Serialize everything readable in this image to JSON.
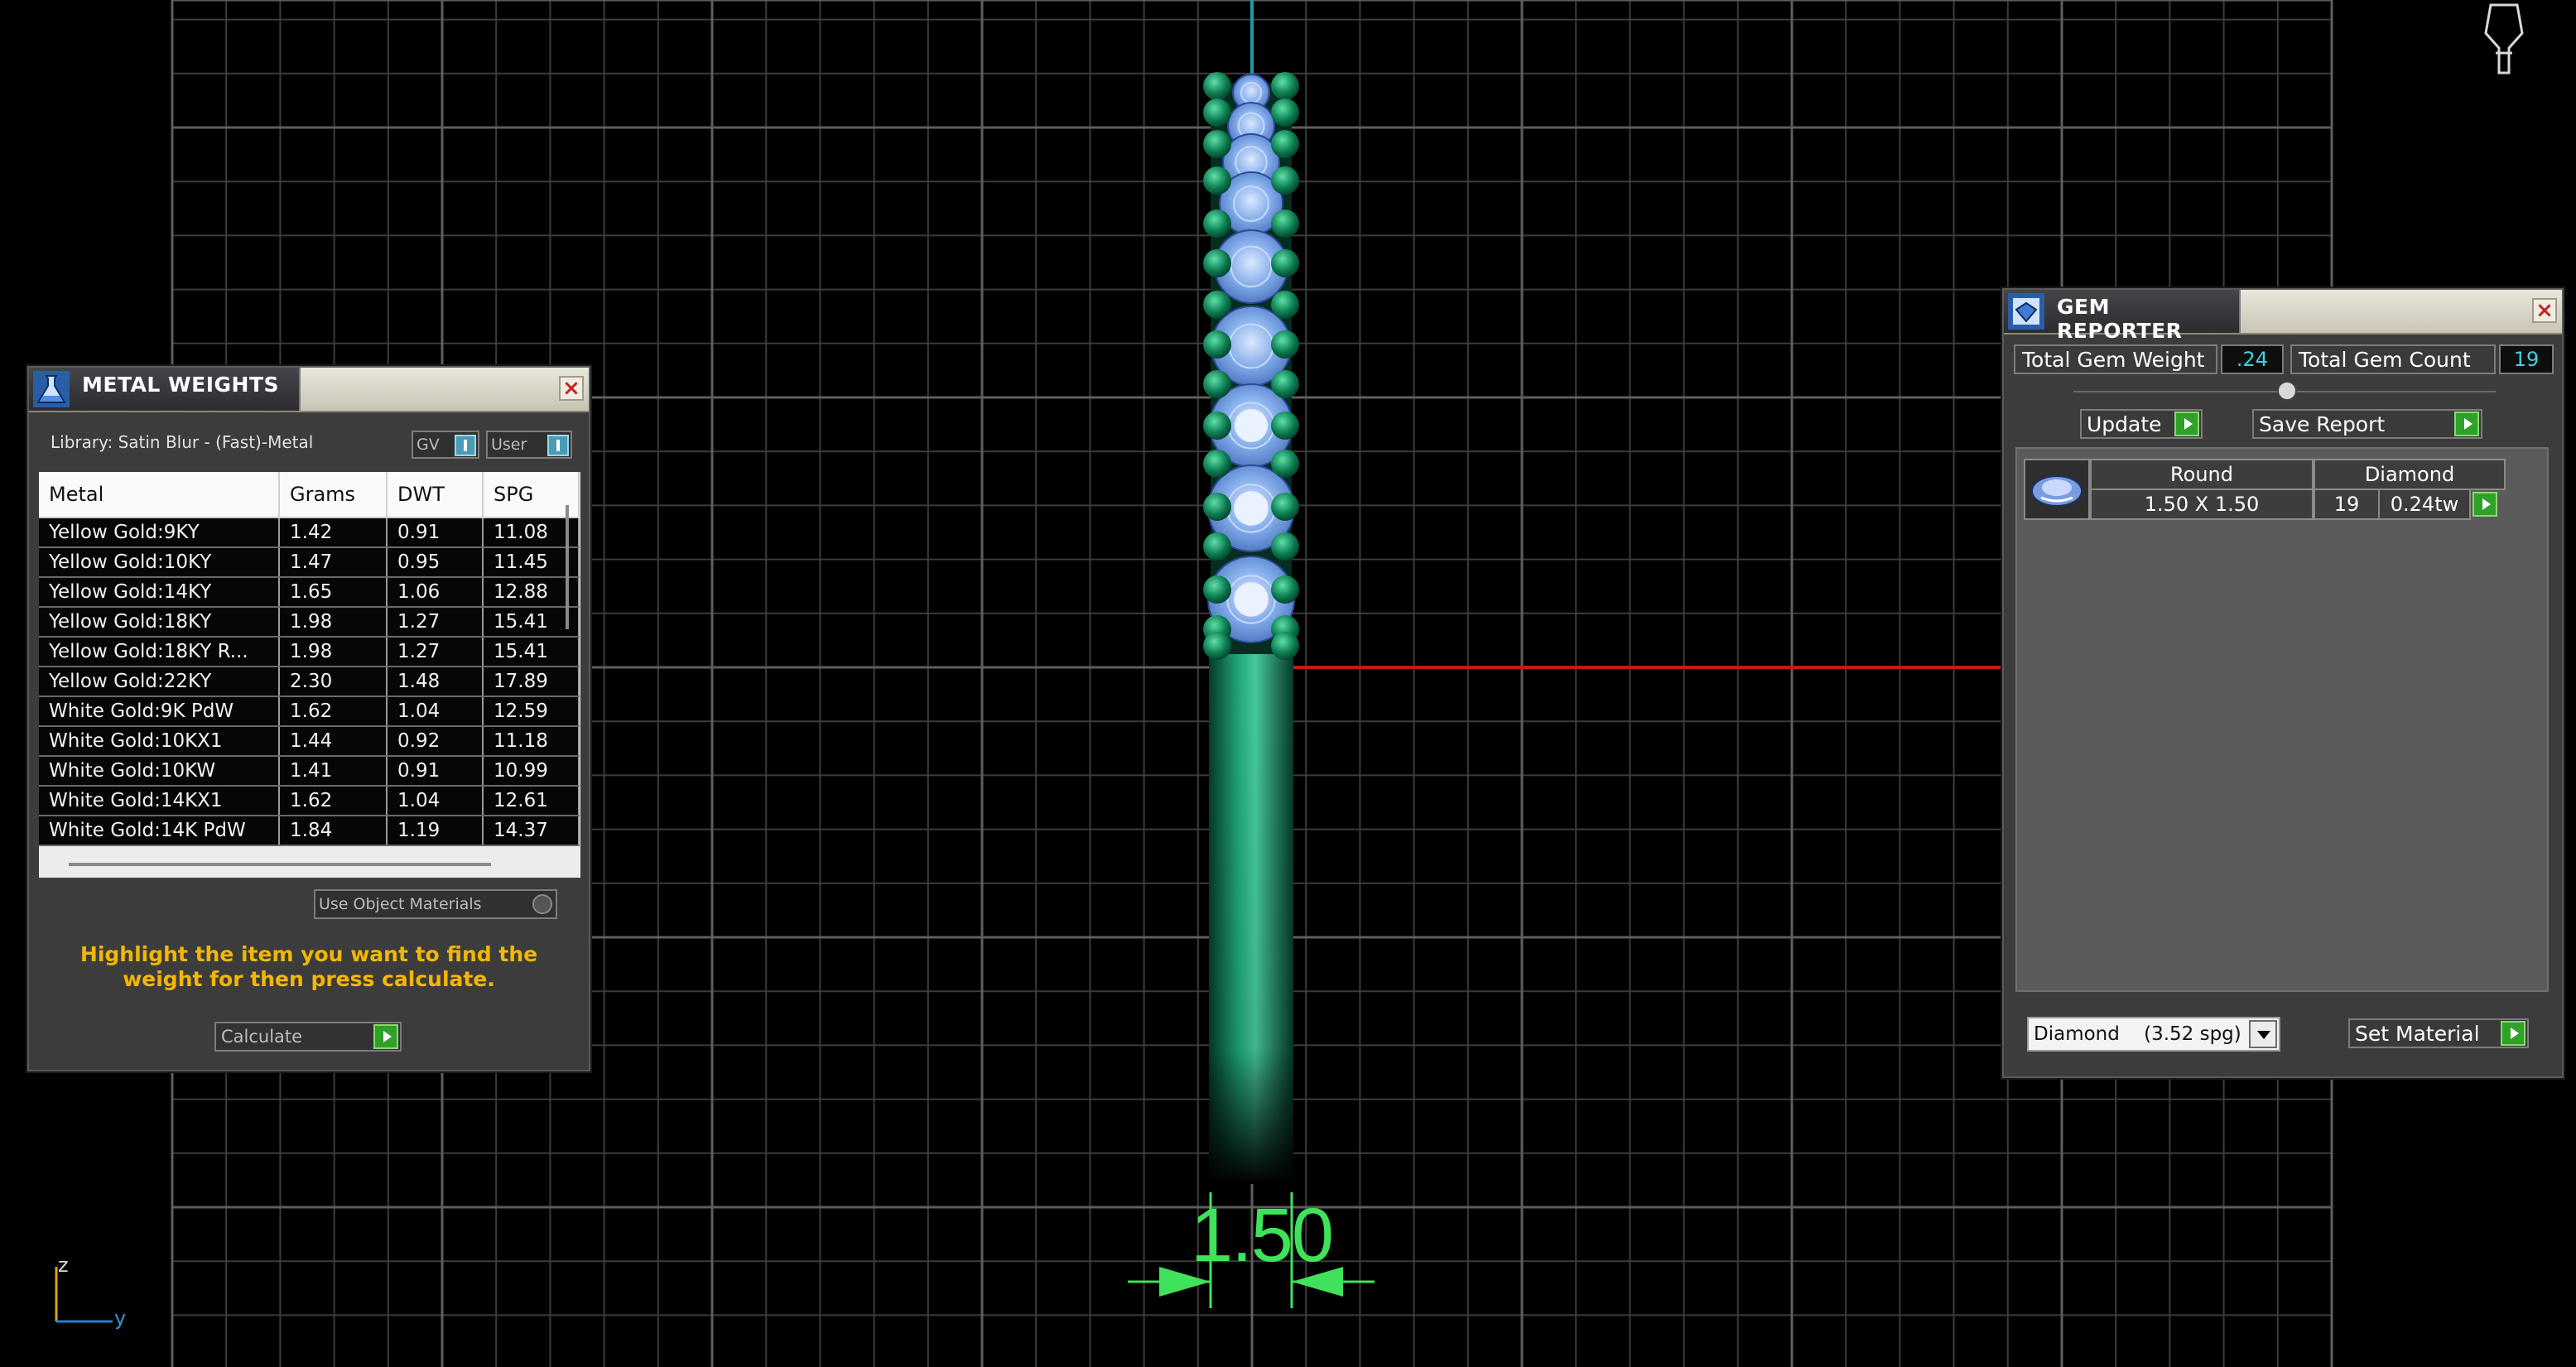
{
  "viewport": {
    "dimension_value": "1.50",
    "axis_labels": {
      "z": "z",
      "y": "y"
    },
    "colors": {
      "grid": "#5e5e5e",
      "ring": "#0a7a55",
      "gem": "#7eaee6",
      "dimension": "#3fe25a",
      "axis_red": "#c8161a",
      "axis_cyan": "#1e9aa8"
    }
  },
  "metal_weights": {
    "title": "METAL WEIGHTS",
    "library": "Library: Satin Blur - (Fast)-Metal",
    "toggles": {
      "gv": "GV",
      "user": "User"
    },
    "columns": [
      "Metal",
      "Grams",
      "DWT",
      "SPG"
    ],
    "rows": [
      [
        "Yellow Gold:9KY",
        "1.42",
        "0.91",
        "11.08"
      ],
      [
        "Yellow Gold:10KY",
        "1.47",
        "0.95",
        "11.45"
      ],
      [
        "Yellow Gold:14KY",
        "1.65",
        "1.06",
        "12.88"
      ],
      [
        "Yellow Gold:18KY",
        "1.98",
        "1.27",
        "15.41"
      ],
      [
        "Yellow Gold:18KY R...",
        "1.98",
        "1.27",
        "15.41"
      ],
      [
        "Yellow Gold:22KY",
        "2.30",
        "1.48",
        "17.89"
      ],
      [
        "White Gold:9K PdW",
        "1.62",
        "1.04",
        "12.59"
      ],
      [
        "White Gold:10KX1",
        "1.44",
        "0.92",
        "11.18"
      ],
      [
        "White Gold:10KW",
        "1.41",
        "0.91",
        "10.99"
      ],
      [
        "White Gold:14KX1",
        "1.62",
        "1.04",
        "12.61"
      ],
      [
        "White Gold:14K PdW",
        "1.84",
        "1.19",
        "14.37"
      ]
    ],
    "use_object_materials": "Use Object Materials",
    "hint": "Highlight the item you want to find the weight for then press calculate.",
    "calculate": "Calculate"
  },
  "gem_reporter": {
    "title": "GEM REPORTER",
    "total_weight_label": "Total Gem Weight",
    "total_weight_value": ".24",
    "total_count_label": "Total Gem Count",
    "total_count_value": "19",
    "update": "Update",
    "save_report": "Save Report",
    "gem": {
      "shape": "Round",
      "material": "Diamond",
      "size": "1.50 X 1.50",
      "count": "19",
      "weight": "0.24tw"
    },
    "material_select": "Diamond    (3.52 spg)",
    "set_material": "Set Material"
  }
}
